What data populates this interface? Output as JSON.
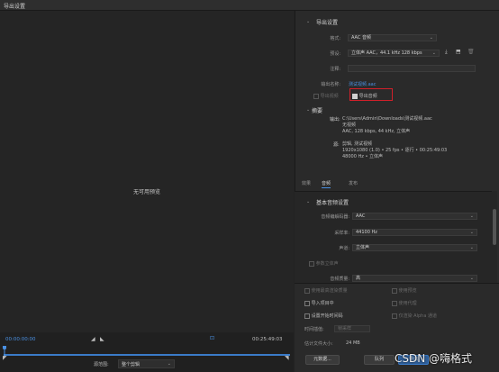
{
  "window": {
    "title": "导出设置"
  },
  "preview": {
    "message": "无可用预览"
  },
  "timeline": {
    "timecode_in": "00:00:00:00",
    "timecode_out": "00:25:49:03",
    "source_range_label": "源范围:",
    "source_range_value": "整个剪辑"
  },
  "export_settings": {
    "header": "导出设置",
    "format_label": "格式:",
    "format_value": "AAC 音频",
    "preset_label": "预设:",
    "preset_value": "立体声 AAC，44.1 kHz 128 kbps",
    "comments_label": "注释:",
    "comments_value": "",
    "output_name_label": "输出名称:",
    "output_name_value": "测试视频.aac",
    "export_video_label": "导出视频",
    "export_audio_label": "导出音频"
  },
  "summary": {
    "header": "摘要",
    "output_label": "输出:",
    "output_lines": [
      "C:\\Users\\Admin\\Downloads\\测试视频.aac",
      "无视频",
      "AAC, 128 kbps, 44  kHz, 立体声"
    ],
    "source_label": "源:",
    "source_lines": [
      "剪辑, 测试视频",
      "1920x1080 (1.0) • 25 fps • 逐行 • 00:25:49:03",
      "48000 Hz • 立体声"
    ]
  },
  "tabs": [
    {
      "label": "效果",
      "active": false
    },
    {
      "label": "音频",
      "active": true
    },
    {
      "label": "发布",
      "active": false
    }
  ],
  "basic_audio": {
    "header": "基本音频设置",
    "codec_label": "音频编解码器:",
    "codec_value": "AAC",
    "sample_rate_label": "采样率:",
    "sample_rate_value": "44100 Hz",
    "channels_label": "声道:",
    "channels_value": "立体声",
    "param_stereo_label": "参数立体声",
    "audio_quality_label": "音频质量:",
    "audio_quality_value": "高"
  },
  "bottom_options": {
    "use_max_render_quality": "使用最高渲染质量",
    "use_previews": "使用预览",
    "import_into_project": "导入项目中",
    "use_proxies": "使用代理",
    "set_start_timecode": "设置开始时间码",
    "render_alpha_only": "仅渲染 Alpha 通道",
    "time_interpolation_label": "时间插值:",
    "time_interpolation_value": "帧采样",
    "estimated_size_label": "估计文件大小:",
    "estimated_size_value": "24 MB",
    "metadata_button": "元数据...",
    "queue_button": "队列",
    "export_button": "导出"
  },
  "watermark": "CSDN @嗨格式",
  "colors": {
    "accent": "#4a90e2",
    "highlight_border": "#d0202a"
  }
}
